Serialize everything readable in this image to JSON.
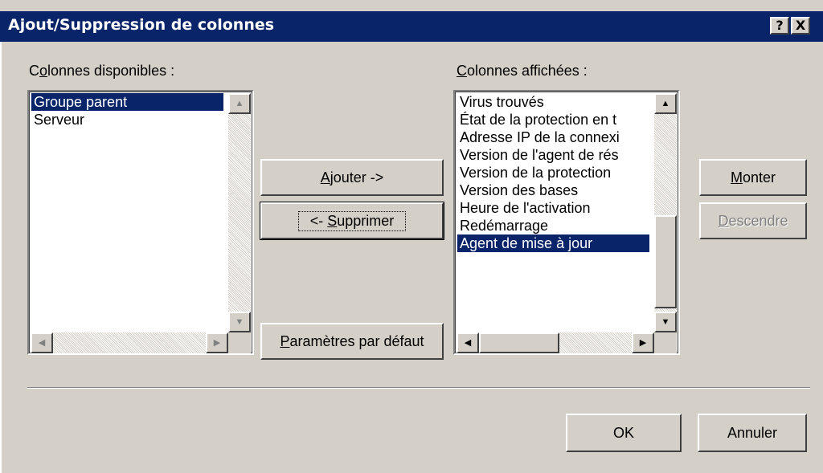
{
  "dialog": {
    "title": "Ajout/Suppression de colonnes",
    "help_label": "?",
    "close_label": "X"
  },
  "available": {
    "label_pre": "C",
    "label_accel": "o",
    "label_post": "lonnes disponibles :",
    "items": [
      {
        "label": "Groupe parent",
        "selected": true
      },
      {
        "label": "Serveur",
        "selected": false
      }
    ]
  },
  "displayed": {
    "label_accel": "C",
    "label_post": "olonnes affichées :",
    "items": [
      {
        "label": "Virus trouvés",
        "selected": false
      },
      {
        "label": "État de la protection en t",
        "selected": false
      },
      {
        "label": "Adresse IP de la connexi",
        "selected": false
      },
      {
        "label": "Version de l'agent de rés",
        "selected": false
      },
      {
        "label": "Version de la protection",
        "selected": false
      },
      {
        "label": "Version des bases",
        "selected": false
      },
      {
        "label": "Heure de l'activation",
        "selected": false
      },
      {
        "label": "Redémarrage",
        "selected": false
      },
      {
        "label": "Agent de mise à jour",
        "selected": true
      }
    ]
  },
  "buttons": {
    "add_accel": "A",
    "add_rest": "jouter ->",
    "remove_pre": "<- ",
    "remove_accel": "S",
    "remove_rest": "upprimer",
    "defaults_accel": "P",
    "defaults_rest": "aramètres par défaut",
    "up_accel": "M",
    "up_rest": "onter",
    "down_accel": "D",
    "down_rest": "escendre",
    "ok": "OK",
    "cancel": "Annuler"
  },
  "scroll_glyphs": {
    "up": "▲",
    "down": "▼",
    "left": "◀",
    "right": "▶"
  },
  "colors": {
    "titlebar": "#0a246a",
    "face": "#d4d0c8",
    "selection": "#0a246a"
  }
}
